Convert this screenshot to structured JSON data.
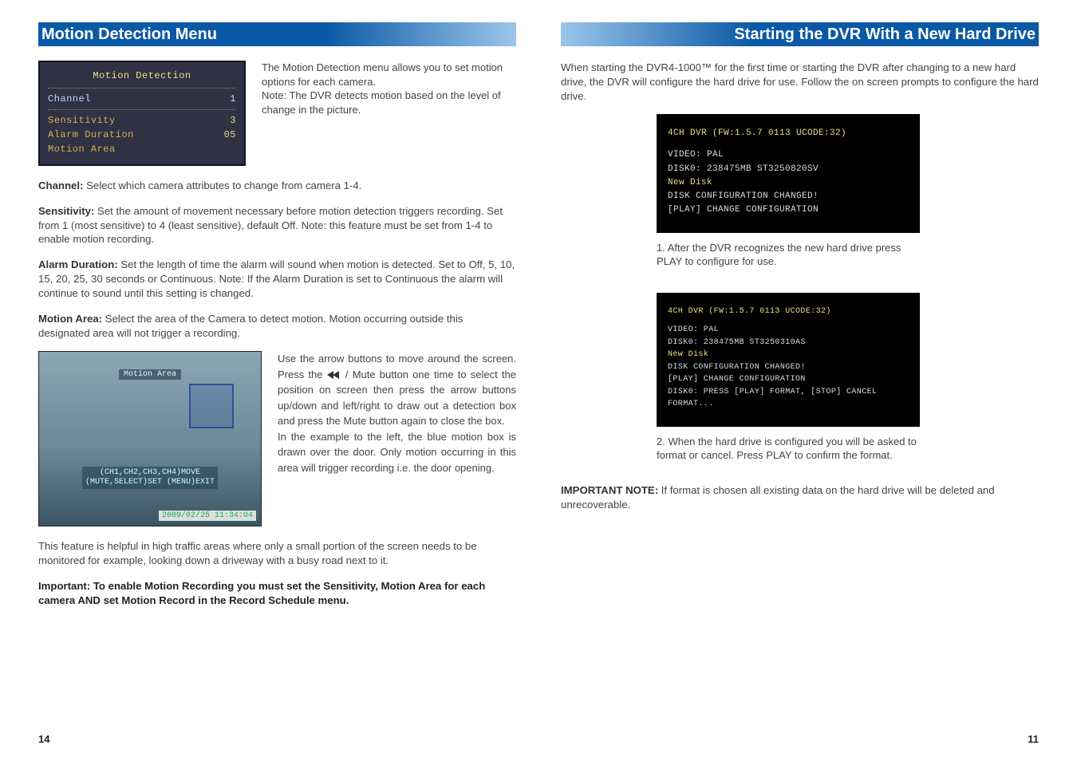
{
  "left": {
    "heading": "Motion Detection Menu",
    "osd": {
      "title": "Motion Detection",
      "rows": [
        {
          "label": "Channel",
          "value": "1"
        },
        {
          "label": "Sensitivity",
          "value": "3"
        },
        {
          "label": "Alarm Duration",
          "value": "05"
        },
        {
          "label": "Motion Area",
          "value": ""
        }
      ]
    },
    "intro1": "The Motion Detection menu allows you to set motion options for each camera.",
    "intro2": "Note: The DVR detects motion based on the level of change in the picture.",
    "channel_label": "Channel:",
    "channel_text": "  Select which camera attributes to change from camera 1-4.",
    "sens_label": "Sensitivity:",
    "sens_text": "  Set the amount of movement necessary before motion detection triggers recording.  Set from 1 (most sensitive) to 4 (least sensitive), default Off.  Note: this feature must be set from 1-4 to enable motion recording.",
    "alarm_label": "Alarm Duration:",
    "alarm_text": "  Set the length of time the alarm will sound when motion is detected.  Set to Off, 5, 10, 15, 20, 25, 30 seconds or Continuous.  Note: If the Alarm Duration is set to Continuous the alarm will continue to sound until this setting is changed.",
    "area_label": "Motion Area:",
    "area_text": "  Select the area of the Camera to detect motion.  Motion occurring outside this designated area will not trigger a recording.",
    "cam": {
      "top_label": "Motion Area",
      "hint": "(CH1,CH2,CH3,CH4)MOVE\n(MUTE,SELECT)SET (MENU)EXIT",
      "timestamp": "2009/02/25 11:34:04"
    },
    "arrows_a": "Use the arrow buttons to move around the screen.  Press the ",
    "arrows_b": " / Mute button one time to select the position on screen then press the arrow buttons up/down and left/right to draw out a detection box and press the Mute button again to close the box.",
    "example": "In the example to the left, the blue motion box is drawn over the door.  Only motion occurring in this area will trigger recording i.e. the door opening.",
    "helpful": "This feature is helpful in high traffic areas where only a small portion of the screen needs to be monitored for example, looking down a driveway with a busy road next to it.",
    "important": "Important:  To enable Motion Recording you must set the Sensitivity,  Motion Area for each camera AND set Motion Record in the Record Schedule menu.",
    "page_num": "14"
  },
  "right": {
    "heading": "Starting the DVR With a New Hard Drive",
    "intro": "When starting the DVR4-1000™ for the first time or starting the DVR after changing to a new hard drive, the DVR will configure the hard drive for use.  Follow the on screen prompts to configure the hard drive.",
    "panel1": {
      "l1": "4CH DVR (FW:1.5.7 0113 UCODE:32)",
      "l2": "VIDEO: PAL",
      "l3": "DISK0: 238475MB ST3250820SV",
      "l4": "New Disk",
      "l5": "DISK CONFIGURATION CHANGED!",
      "l6": "[PLAY] CHANGE CONFIGURATION"
    },
    "cap1": "1. After the DVR recognizes the new hard drive press PLAY to configure for use.",
    "panel2": {
      "l1": "4CH DVR (FW:1.5.7 0113 UCODE:32)",
      "l2": "VIDEO: PAL",
      "l3": "DISK0: 238475MB ST3250310AS",
      "l4": "New Disk",
      "l5": "DISK CONFIGURATION CHANGED!",
      "l6": "[PLAY] CHANGE CONFIGURATION",
      "l7": "DISK0: PRESS [PLAY] FORMAT, [STOP] CANCEL",
      "l8": "FORMAT..."
    },
    "cap2": "2.  When the hard drive is configured you will be asked to format or cancel.  Press PLAY to confirm the format.",
    "note_label": "IMPORTANT NOTE:",
    "note_text": "  If format is chosen all existing data on the hard drive will be deleted and unrecoverable.",
    "page_num": "11"
  }
}
